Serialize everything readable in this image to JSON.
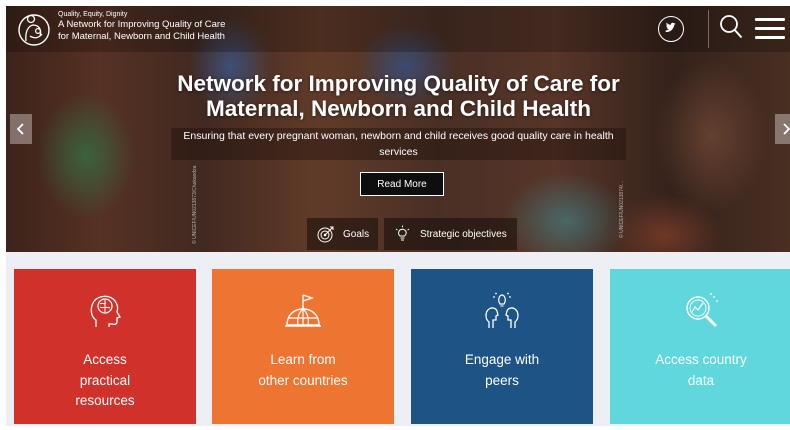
{
  "header": {
    "tagline": "Quality, Equity, Dignity",
    "brand_line1": "A Network for Improving Quality of Care",
    "brand_line2": "for Maternal, Newborn and Child Health"
  },
  "hero": {
    "title_line1": "Network for Improving Quality of Care for",
    "title_line2": "Maternal, Newborn and Child Health",
    "subtitle_line1": "Ensuring that every pregnant woman, newborn and child receives good quality care in health",
    "subtitle_line2": "services",
    "read_more": "Read More",
    "goals": "Goals",
    "strategic_objectives": "Strategic objectives",
    "credit_left": "© UNICEF/UN0213873/Chakaodza",
    "credit_mid": "",
    "credit_right": "© UNICEF/UN0213874/..."
  },
  "cards": [
    {
      "line1": "Access",
      "line2": "practical",
      "line3": "resources",
      "icon": "brain-head-icon",
      "color": "#d0322b"
    },
    {
      "line1": "Learn from",
      "line2": "other countries",
      "line3": "",
      "icon": "globe-flag-icon",
      "color": "#ed7431"
    },
    {
      "line1": "Engage with",
      "line2": "peers",
      "line3": "",
      "icon": "peers-idea-icon",
      "color": "#1d5485"
    },
    {
      "line1": "Access country",
      "line2": "data",
      "line3": "",
      "icon": "data-magnifier-icon",
      "color": "#5fd7dc"
    }
  ],
  "icons": {
    "logo": "mother-child-logo-icon",
    "twitter": "twitter-icon",
    "search": "search-icon",
    "menu": "hamburger-menu-icon",
    "prev": "chevron-left-icon",
    "next": "chevron-right-icon",
    "goals": "target-icon",
    "objectives": "lightbulb-icon"
  }
}
